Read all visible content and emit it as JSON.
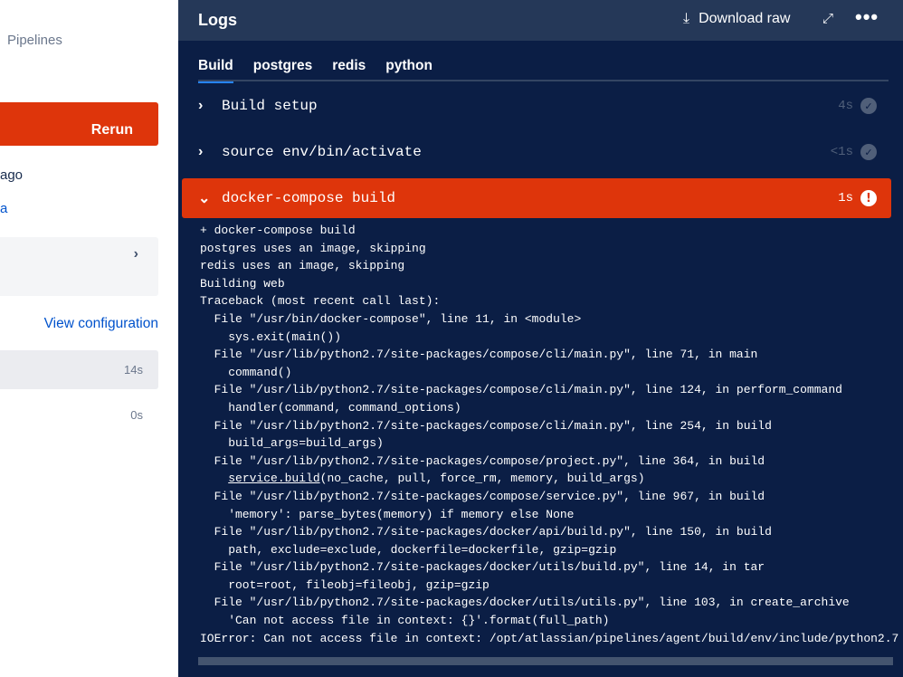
{
  "sidebar": {
    "breadcrumb": "Pipelines",
    "rerun_label": "Rerun",
    "time_ago": "ago",
    "link_fragment": "a",
    "card_chevron": "›",
    "view_configuration": "View configuration",
    "steps": [
      {
        "duration": "14s"
      },
      {
        "duration": "0s"
      }
    ]
  },
  "logs": {
    "title": "Logs",
    "download_raw": "Download raw",
    "tabs": [
      {
        "label": "Build"
      },
      {
        "label": "postgres"
      },
      {
        "label": "redis"
      },
      {
        "label": "python"
      }
    ],
    "steps": [
      {
        "name": "Build setup",
        "duration": "4s",
        "status": "success"
      },
      {
        "name": "source env/bin/activate",
        "duration": "<1s",
        "status": "success"
      },
      {
        "name": "docker-compose build",
        "duration": "1s",
        "status": "failed"
      }
    ],
    "lines": [
      "+ docker-compose build",
      "postgres uses an image, skipping",
      "redis uses an image, skipping",
      "Building web",
      "Traceback (most recent call last):",
      "  File \"/usr/bin/docker-compose\", line 11, in <module>",
      "    sys.exit(main())",
      "  File \"/usr/lib/python2.7/site-packages/compose/cli/main.py\", line 71, in main",
      "    command()",
      "  File \"/usr/lib/python2.7/site-packages/compose/cli/main.py\", line 124, in perform_command",
      "    handler(command, command_options)",
      "  File \"/usr/lib/python2.7/site-packages/compose/cli/main.py\", line 254, in build",
      "    build_args=build_args)",
      "  File \"/usr/lib/python2.7/site-packages/compose/project.py\", line 364, in build",
      "    ",
      "  File \"/usr/lib/python2.7/site-packages/compose/service.py\", line 967, in build",
      "    'memory': parse_bytes(memory) if memory else None",
      "  File \"/usr/lib/python2.7/site-packages/docker/api/build.py\", line 150, in build",
      "    path, exclude=exclude, dockerfile=dockerfile, gzip=gzip",
      "  File \"/usr/lib/python2.7/site-packages/docker/utils/build.py\", line 14, in tar",
      "    root=root, fileobj=fileobj, gzip=gzip",
      "  File \"/usr/lib/python2.7/site-packages/docker/utils/utils.py\", line 103, in create_archive",
      "    'Can not access file in context: {}'.format(full_path)",
      "IOError: Can not access file in context: /opt/atlassian/pipelines/agent/build/env/include/python2.7"
    ],
    "link_line": {
      "link": "service.build",
      "rest": "(no_cache, pull, force_rm, memory, build_args)"
    }
  }
}
